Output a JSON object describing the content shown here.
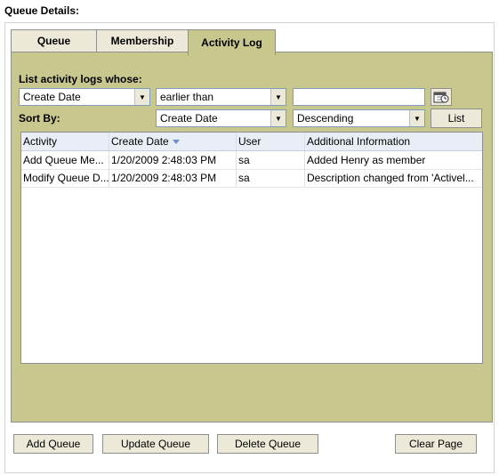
{
  "section_title": "Queue Details:",
  "tabs": [
    {
      "label": "Queue",
      "active": false
    },
    {
      "label": "Membership",
      "active": false
    },
    {
      "label": "Activity Log",
      "active": true
    }
  ],
  "filter": {
    "heading": "List activity logs whose:",
    "field": "Create Date",
    "operator": "earlier than",
    "value": ""
  },
  "sort": {
    "label": "Sort By:",
    "field": "Create Date",
    "order": "Descending",
    "list_button": "List"
  },
  "grid": {
    "columns": [
      "Activity",
      "Create Date",
      "User",
      "Additional Information"
    ],
    "sorted_column": "Create Date",
    "rows": [
      {
        "activity": "Add Queue Me...",
        "create_date": "1/20/2009 2:48:03 PM",
        "user": "sa",
        "info": "Added Henry as member"
      },
      {
        "activity": "Modify Queue D...",
        "create_date": "1/20/2009 2:48:03 PM",
        "user": "sa",
        "info": "Description changed from 'Activel..."
      }
    ]
  },
  "buttons": {
    "add": "Add Queue",
    "update": "Update Queue",
    "delete": "Delete Queue",
    "clear": "Clear Page"
  },
  "colors": {
    "panel": "#c7c78e",
    "header": "#e9edf6",
    "button": "#ece9d8"
  },
  "icons": [
    "calendar-clock-icon",
    "chevron-down-icon",
    "sort-desc-icon"
  ]
}
